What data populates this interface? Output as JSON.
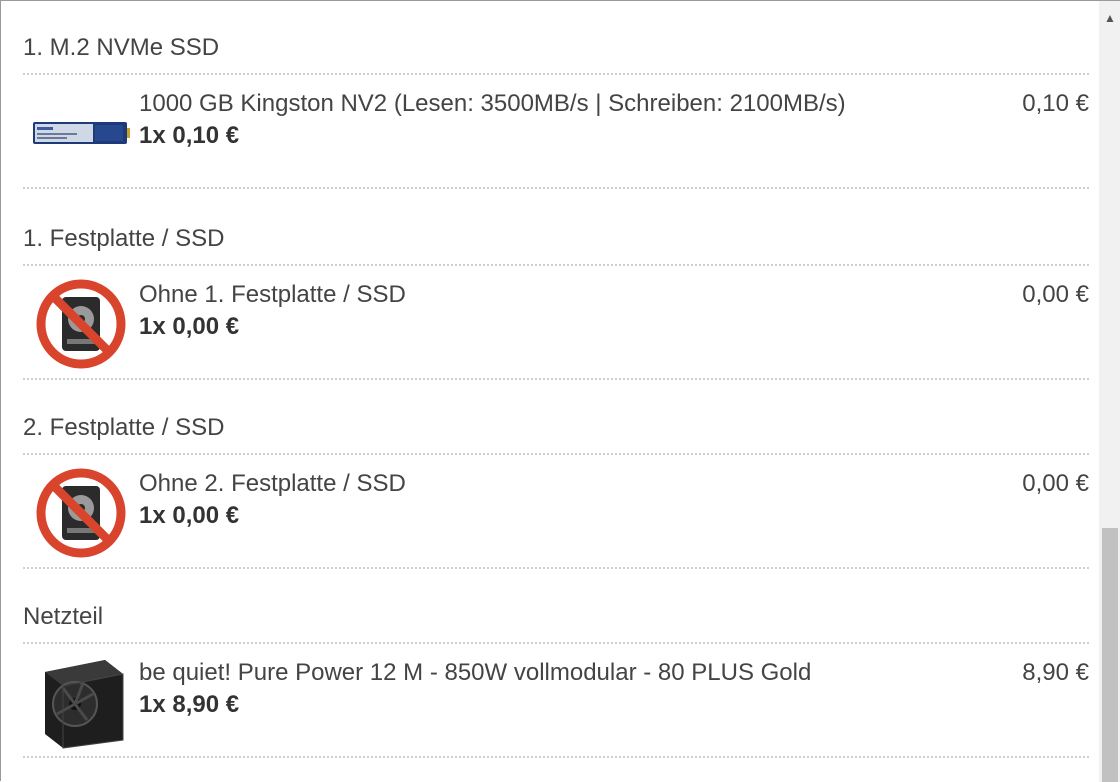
{
  "sections": [
    {
      "title": "1. M.2 NVMe SSD",
      "item": {
        "name": "1000 GB Kingston NV2 (Lesen: 3500MB/s | Schreiben: 2100MB/s)",
        "qty": "1x 0,10 €",
        "price": "0,10 €",
        "icon": "ssd-module-icon"
      }
    },
    {
      "title": "1. Festplatte / SSD",
      "item": {
        "name": "Ohne 1. Festplatte / SSD",
        "qty": "1x 0,00 €",
        "price": "0,00 €",
        "icon": "no-drive-icon"
      }
    },
    {
      "title": "2. Festplatte / SSD",
      "item": {
        "name": "Ohne 2. Festplatte / SSD",
        "qty": "1x 0,00 €",
        "price": "0,00 €",
        "icon": "no-drive-icon"
      }
    },
    {
      "title": "Netzteil",
      "item": {
        "name": "be quiet! Pure Power 12 M - 850W vollmodular - 80 PLUS Gold",
        "qty": "1x 8,90 €",
        "price": "8,90 €",
        "icon": "power-supply-icon"
      }
    }
  ],
  "scrollbar": {
    "up_glyph": "▲"
  },
  "colors": {
    "no_sign_red": "#d9452c",
    "text": "#444444"
  }
}
